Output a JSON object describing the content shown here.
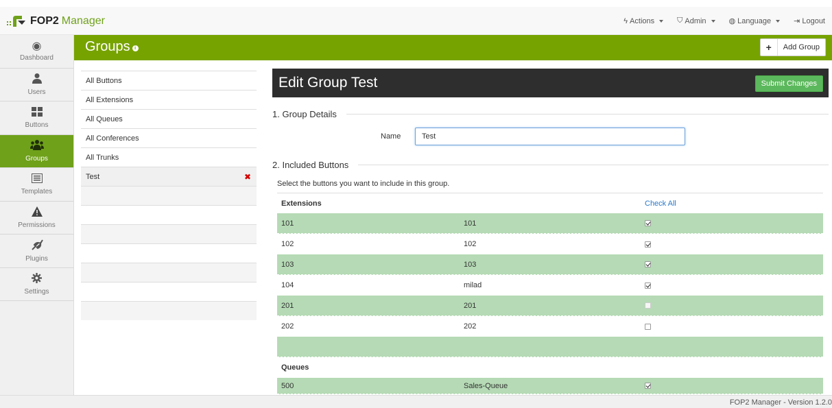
{
  "brand": {
    "name": "FOP2",
    "manager": "Manager"
  },
  "topnav": [
    {
      "icon": "bolt-icon",
      "label": "Actions"
    },
    {
      "icon": "shield-icon",
      "label": "Admin"
    },
    {
      "icon": "globe-icon",
      "label": "Language"
    },
    {
      "icon": "logout-icon",
      "label": "Logout"
    }
  ],
  "sidebar": [
    {
      "id": "dashboard",
      "icon": "dashboard-icon",
      "label": "Dashboard"
    },
    {
      "id": "users",
      "icon": "user-icon",
      "label": "Users"
    },
    {
      "id": "buttons",
      "icon": "grid-icon",
      "label": "Buttons"
    },
    {
      "id": "groups",
      "icon": "group-icon",
      "label": "Groups",
      "active": true
    },
    {
      "id": "templates",
      "icon": "template-icon",
      "label": "Templates"
    },
    {
      "id": "permissions",
      "icon": "warning-icon",
      "label": "Permissions"
    },
    {
      "id": "plugins",
      "icon": "plug-icon",
      "label": "Plugins"
    },
    {
      "id": "settings",
      "icon": "gear-icon",
      "label": "Settings"
    }
  ],
  "page": {
    "title": "Groups",
    "add_button": "Add Group"
  },
  "groups": [
    "All Buttons",
    "All Extensions",
    "All Queues",
    "All Conferences",
    "All Trunks",
    "Test"
  ],
  "edit": {
    "title": "Edit Group Test",
    "submit": "Submit Changes",
    "section1": "1. Group Details",
    "name_label": "Name",
    "name_value": "Test",
    "section2": "2. Included Buttons",
    "help": "Select the buttons you want to include in this group."
  },
  "table": {
    "extensions_header": "Extensions",
    "check_all": "Check All",
    "extensions": [
      {
        "id": "101",
        "name": "101",
        "checked": true
      },
      {
        "id": "102",
        "name": "102",
        "checked": true
      },
      {
        "id": "103",
        "name": "103",
        "checked": true
      },
      {
        "id": "104",
        "name": "milad",
        "checked": true
      },
      {
        "id": "201",
        "name": "201",
        "checked": false
      },
      {
        "id": "202",
        "name": "202",
        "checked": false
      }
    ],
    "queues_header": "Queues",
    "queues": [
      {
        "id": "500",
        "name": "Sales-Queue",
        "checked": true
      }
    ]
  },
  "footer": "FOP2 Manager - Version 1.2.0"
}
